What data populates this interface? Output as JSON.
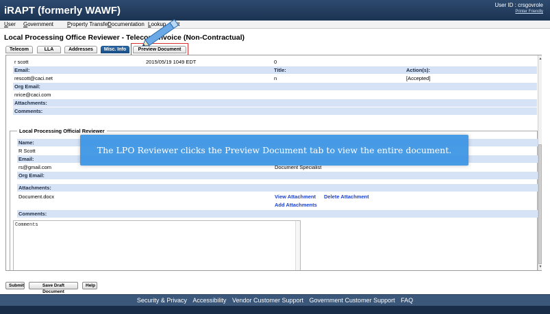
{
  "app": {
    "title": "iRAPT (formerly WAWF)",
    "user_id": "User ID : crsgovrole",
    "printer_friendly": "Printer Friendly"
  },
  "menu": [
    "User",
    "Government",
    "Property Transfer",
    "Documentation",
    "Lookup",
    "Exit"
  ],
  "page_title": "Local Processing Office Reviewer - Telecom Invoice (Non-Contractual)",
  "tabs": [
    "Telecom",
    "LLA",
    "Addresses",
    "Misc. Info",
    "Preview Document"
  ],
  "top_section": {
    "row1": {
      "name": "r scott",
      "date": "2015/05/19 1049 EDT",
      "value": "0"
    },
    "labels": {
      "email": "Email:",
      "title": "Title:",
      "actions": "Action(s):",
      "org_email": "Org Email:",
      "attachments": "Attachments:",
      "comments": "Comments:"
    },
    "email": "rescott@caci.net",
    "title": "n",
    "action": "[Accepted]",
    "org_email": "nrice@caci.com"
  },
  "lpo_section": {
    "legend": "Local Processing Official Reviewer",
    "labels": {
      "name": "Name:",
      "email": "Email:",
      "org_email": "Org Email:",
      "attachments": "Attachments:",
      "comments": "Comments:"
    },
    "name": "R Scott",
    "email": "rs@gmail.com",
    "title": "Document Specialist",
    "attachment_file": "Document.docx",
    "view_attachment": "View Attachment",
    "delete_attachment": "Delete Attachment",
    "add_attachments": "Add Attachments",
    "comments_value": "Comments"
  },
  "buttons": {
    "submit": "Submit",
    "save_draft": "Save Draft Document",
    "help": "Help"
  },
  "footer": [
    "Security & Privacy",
    "Accessibility",
    "Vendor Customer Support",
    "Government Customer Support",
    "FAQ"
  ],
  "callout": "The LPO Reviewer clicks the Preview Document tab to view the entire document.",
  "colors": {
    "header": "#1c3352",
    "band": "#d6e3f7",
    "active_tab": "#1b4f86",
    "callout": "#3e96e4",
    "highlight": "#d63030"
  }
}
